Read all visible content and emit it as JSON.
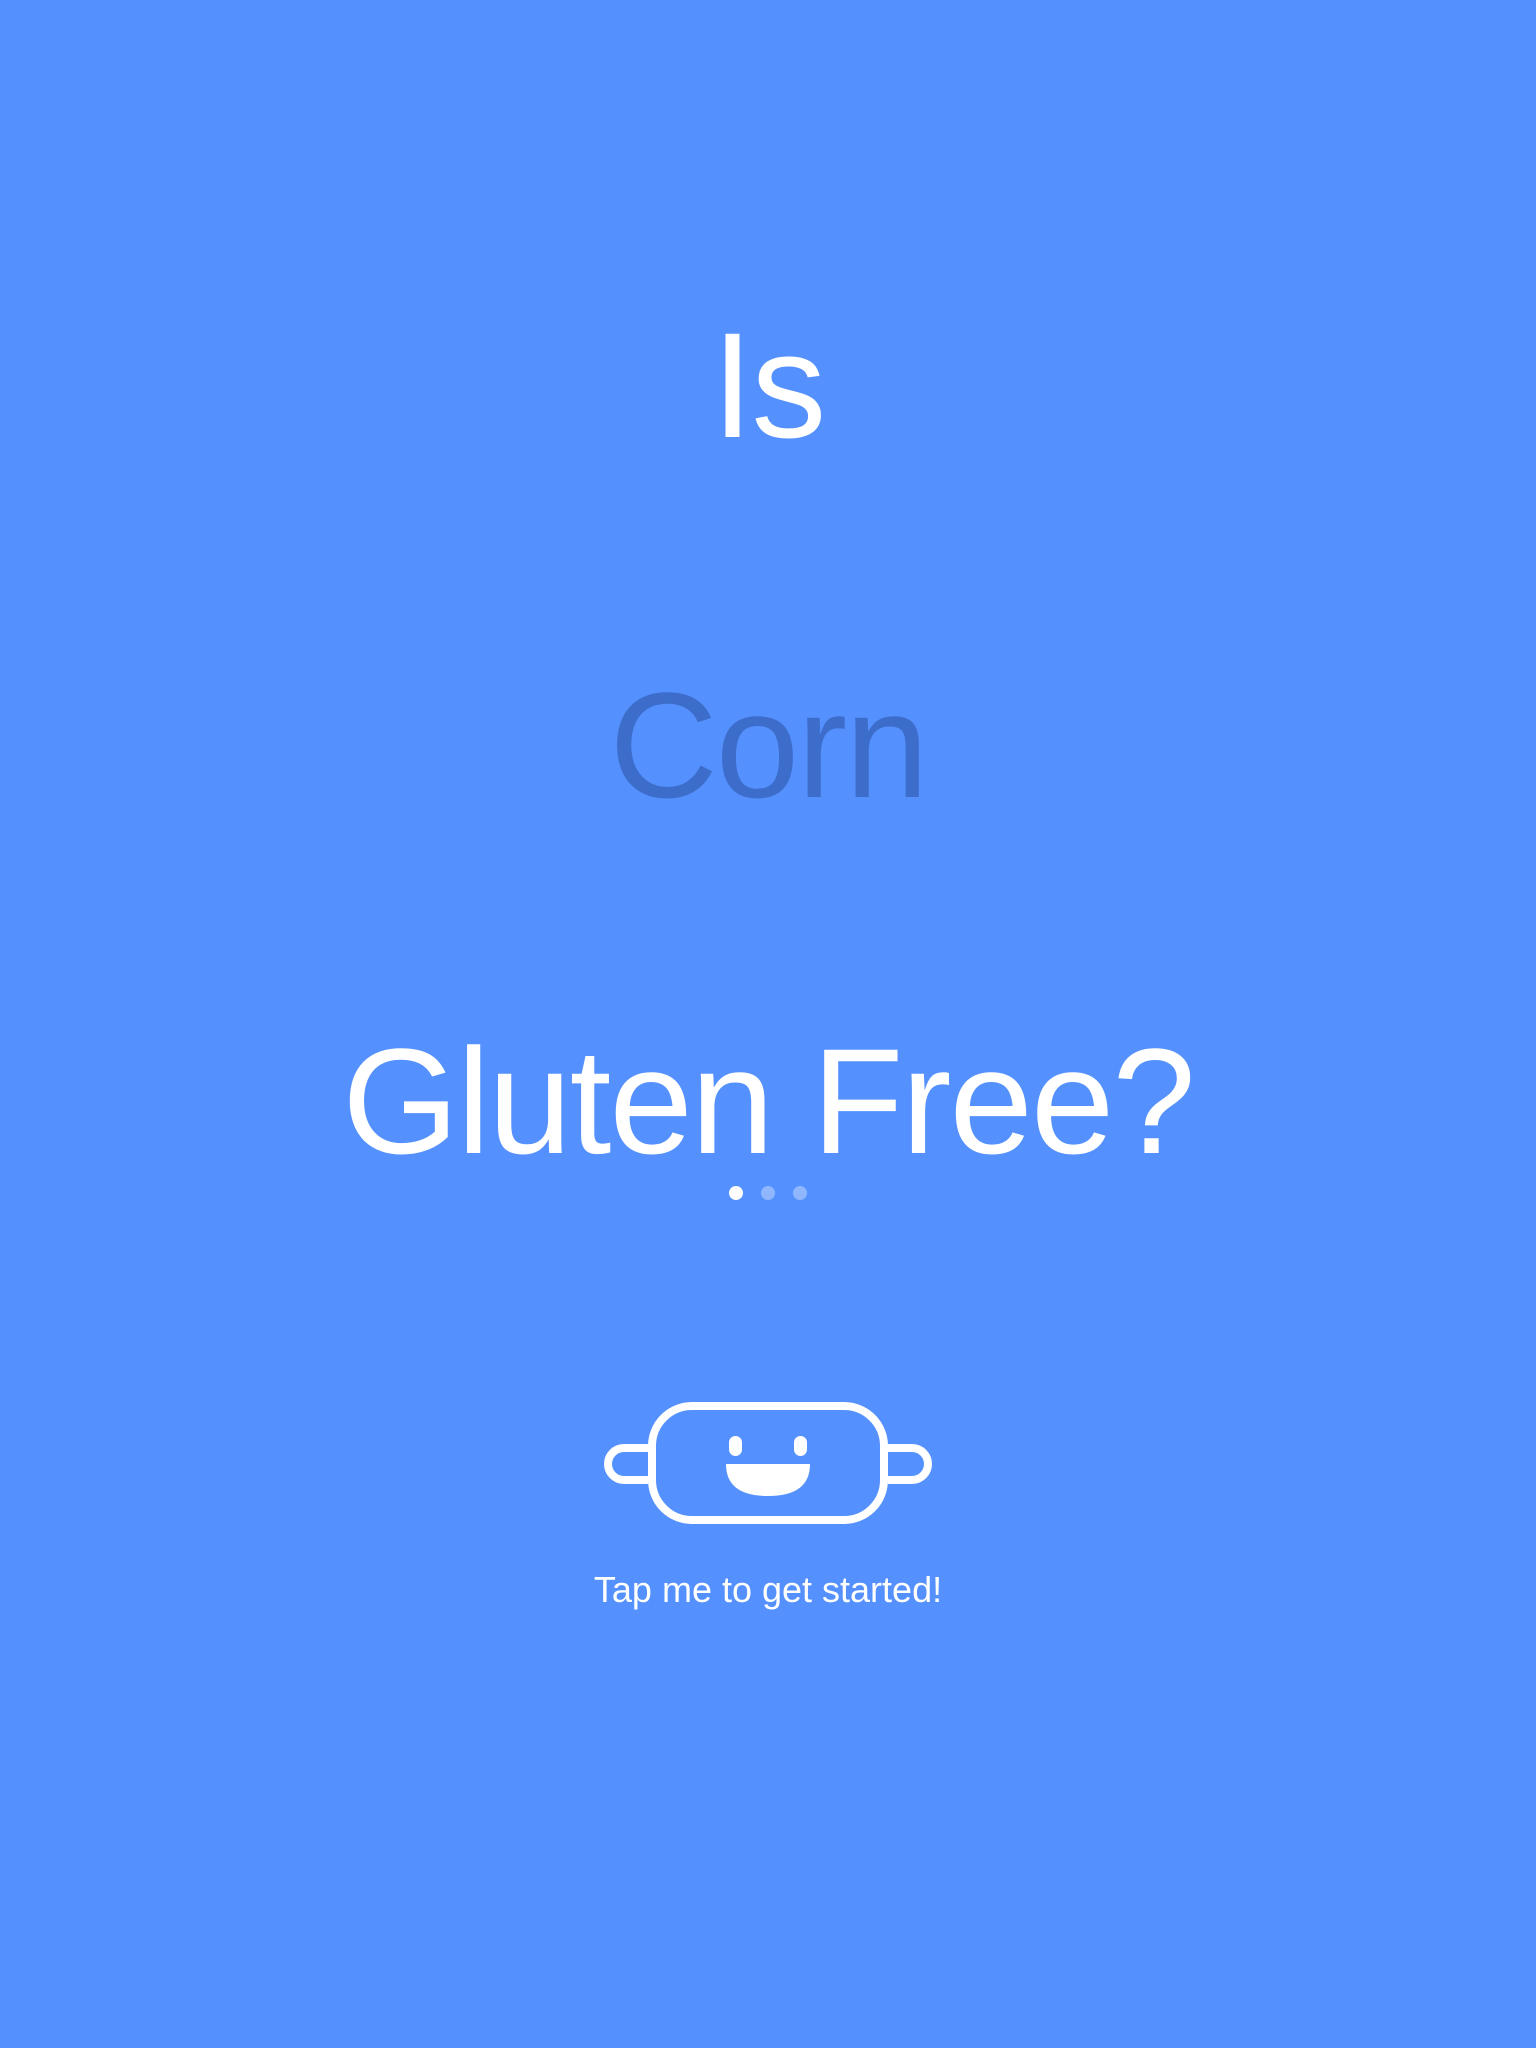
{
  "headline": {
    "line1": "Is",
    "line2": "Corn",
    "line3": "Gluten Free?"
  },
  "pager": {
    "total": 3,
    "active_index": 0
  },
  "mascot": {
    "icon": "rolling-pin-smiley-icon"
  },
  "cta": {
    "text": "Tap me to get started!"
  },
  "colors": {
    "background": "#5591fe",
    "foreground": "#ffffff",
    "highlight_word": "#3d6dca"
  }
}
